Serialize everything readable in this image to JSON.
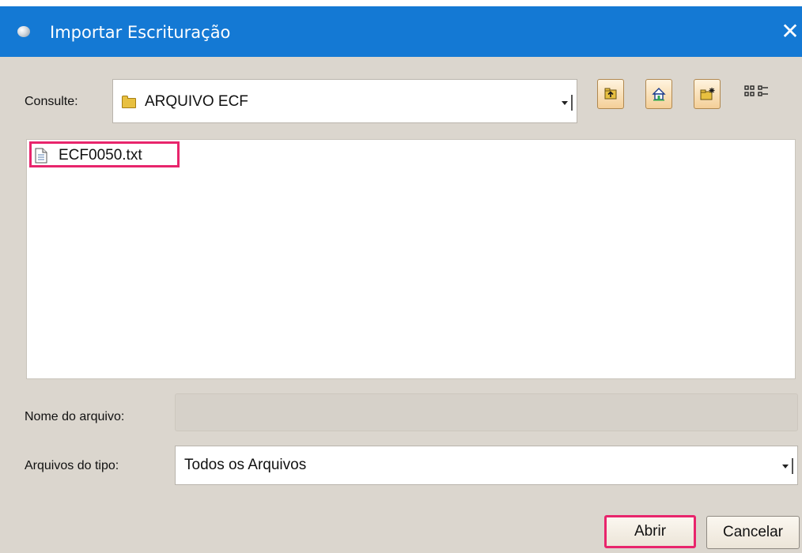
{
  "dialog": {
    "title": "Importar Escrituração",
    "close_glyph": "✕",
    "icon": "app-icon"
  },
  "lookin": {
    "label": "Consulte:",
    "value": "ARQUIVO ECF",
    "icon": "folder-icon"
  },
  "toolbar": {
    "buttons": [
      "up-folder-icon",
      "home-icon",
      "new-folder-icon",
      "list-view-icon"
    ]
  },
  "files": [
    {
      "name": "ECF0050.txt",
      "icon": "text-file-icon",
      "highlighted": true
    }
  ],
  "filename": {
    "label": "Nome do arquivo:",
    "value": ""
  },
  "filetype": {
    "label": "Arquivos do tipo:",
    "value": "Todos os Arquivos"
  },
  "buttons": {
    "open": "Abrir",
    "cancel": "Cancelar"
  },
  "colors": {
    "titlebar": "#1479d4",
    "dialog_bg": "#dbd6ce",
    "highlight": "#e8256c",
    "toolbar_button": "#f4cf98"
  }
}
